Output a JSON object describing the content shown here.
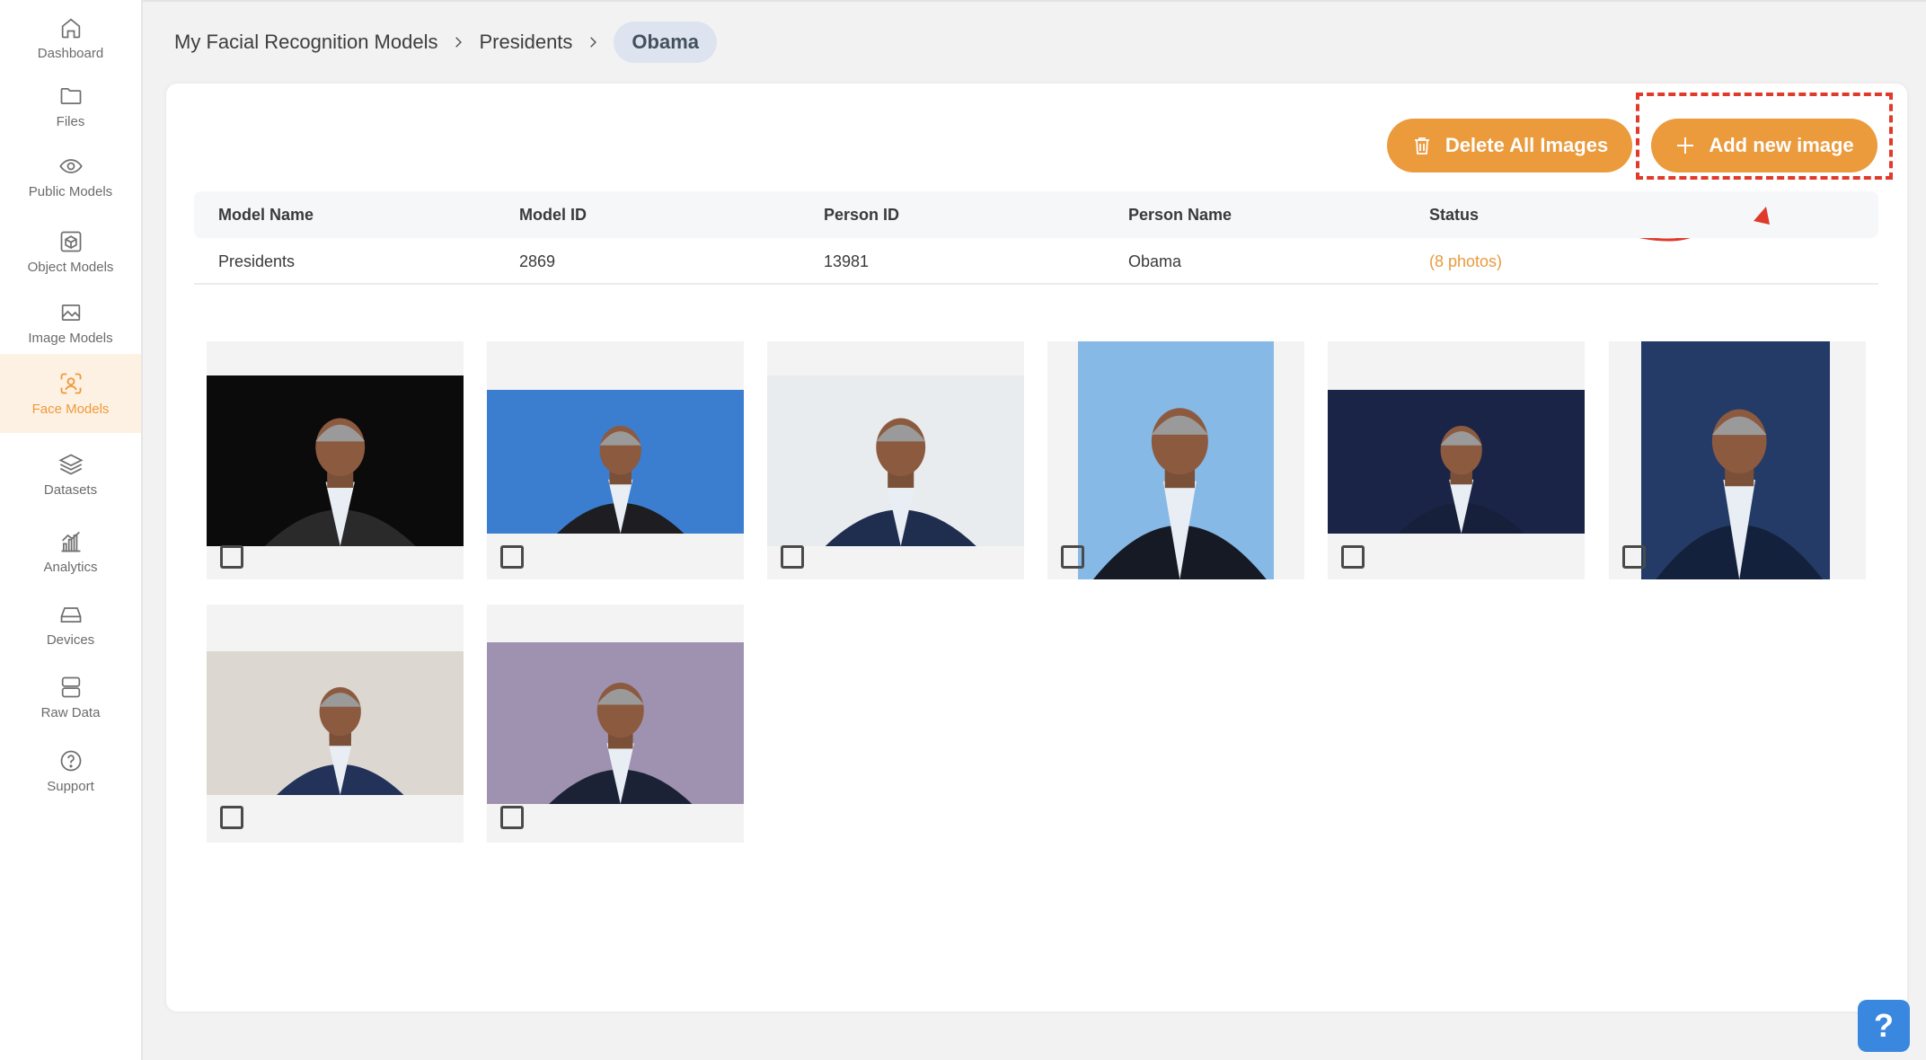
{
  "sidebar": {
    "items": [
      {
        "label": "Dashboard",
        "icon": "home-icon"
      },
      {
        "label": "Files",
        "icon": "folder-icon"
      },
      {
        "label": "Public Models",
        "icon": "eye-icon"
      },
      {
        "label": "Object Models",
        "icon": "cube-icon"
      },
      {
        "label": "Image Models",
        "icon": "image-icon"
      },
      {
        "label": "Face Models",
        "icon": "face-scan-icon",
        "active": true
      },
      {
        "label": "Datasets",
        "icon": "layers-icon"
      },
      {
        "label": "Analytics",
        "icon": "chart-icon"
      },
      {
        "label": "Devices",
        "icon": "drive-icon"
      },
      {
        "label": "Raw Data",
        "icon": "database-icon"
      },
      {
        "label": "Support",
        "icon": "help-circle-icon"
      }
    ],
    "active_color": "#f0993a"
  },
  "breadcrumb": {
    "items": [
      "My Facial Recognition Models",
      "Presidents"
    ],
    "current": "Obama"
  },
  "actions": {
    "delete_all_label": "Delete All Images",
    "add_new_label": "Add new image",
    "button_color": "#eb9a3c"
  },
  "table": {
    "headers": [
      "Model Name",
      "Model ID",
      "Person ID",
      "Person Name",
      "Status"
    ],
    "row": [
      "Presidents",
      "2869",
      "13981",
      "Obama",
      "(8 photos)"
    ]
  },
  "images": [
    {
      "name": "photo-1",
      "bg": "#0b0b0b",
      "suit": "#2a2a2a"
    },
    {
      "name": "photo-2",
      "bg": "#3b7ed0",
      "suit": "#1d1d22"
    },
    {
      "name": "photo-3",
      "bg": "#e9ecef",
      "suit": "#1f2d4f"
    },
    {
      "name": "photo-4",
      "bg": "#87b9e6",
      "suit": "#151a25"
    },
    {
      "name": "photo-5",
      "bg": "#1a2446",
      "suit": "#17203a"
    },
    {
      "name": "photo-6",
      "bg": "#233b66",
      "suit": "#14213d"
    },
    {
      "name": "photo-7",
      "bg": "#dcd8d1",
      "suit": "#223259"
    },
    {
      "name": "photo-8",
      "bg": "#9f92b0",
      "suit": "#1b2236"
    }
  ],
  "annotation": {
    "color": "#e03b2a"
  },
  "help": {
    "label": "?"
  }
}
